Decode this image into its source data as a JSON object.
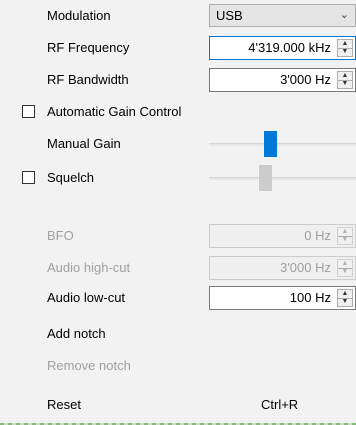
{
  "panel": {
    "modulation": {
      "label": "Modulation",
      "selected": "USB",
      "options": [
        "USB"
      ]
    },
    "rf_frequency": {
      "label": "RF Frequency",
      "value": "4'319.000 kHz"
    },
    "rf_bandwidth": {
      "label": "RF Bandwidth",
      "value": "3'000 Hz"
    },
    "agc": {
      "label": "Automatic Gain Control",
      "checked": false
    },
    "manual_gain": {
      "label": "Manual Gain",
      "level": 0.41
    },
    "squelch": {
      "label": "Squelch",
      "checked": false,
      "level": 0.37,
      "enabled": false
    },
    "bfo": {
      "label": "BFO",
      "value": "0 Hz",
      "enabled": false
    },
    "audio_high_cut": {
      "label": "Audio high-cut",
      "value": "3'000 Hz",
      "enabled": false
    },
    "audio_low_cut": {
      "label": "Audio low-cut",
      "value": "100 Hz",
      "enabled": true
    },
    "menu": {
      "add_notch": "Add notch",
      "remove_notch": "Remove notch",
      "reset": "Reset",
      "reset_shortcut": "Ctrl+R"
    }
  },
  "colors": {
    "accent": "#0078d7",
    "disabled_text": "#a0a0a0",
    "background": "#f2f2f2"
  },
  "icons": {
    "combo_arrow": "chevron-down-icon",
    "spin_up": "caret-up-icon",
    "spin_down": "caret-down-icon"
  }
}
